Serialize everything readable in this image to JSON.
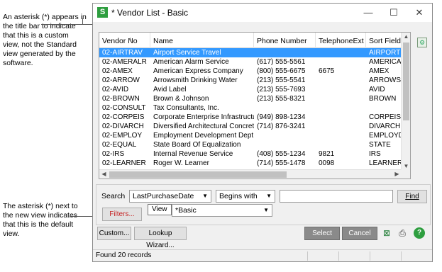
{
  "callouts": {
    "top": "An asterisk (*) appears in the title bar to indicate that this is a custom view, not the Standard view generated by the software.",
    "bottom": "The asterisk (*) next to the new view indicates that this is the default view."
  },
  "window": {
    "title": "* Vendor List - Basic",
    "app_icon_letter": "S",
    "minimize": "—",
    "maximize": "☐",
    "close": "✕"
  },
  "grid": {
    "columns": [
      "Vendor No",
      "Name",
      "Phone Number",
      "TelephoneExt",
      "Sort Field"
    ],
    "rows": [
      [
        "02-AIRTRAV",
        "Airport Service Travel",
        "",
        "",
        "AIRPORT"
      ],
      [
        "02-AMERALR",
        "American Alarm Service",
        "(617) 555-5561",
        "",
        "AMERICAN"
      ],
      [
        "02-AMEX",
        "American Express Company",
        "(800) 555-6675",
        "6675",
        "AMEX"
      ],
      [
        "02-ARROW",
        "Arrowsmith Drinking Water",
        "(213) 555-5541",
        "",
        "ARROWSM"
      ],
      [
        "02-AVID",
        "Avid Label",
        "(213) 555-7693",
        "",
        "AVID"
      ],
      [
        "02-BROWN",
        "Brown & Johnson",
        "(213) 555-8321",
        "",
        "BROWN"
      ],
      [
        "02-CONSULT",
        "Tax Consultants, Inc.",
        "",
        "",
        ""
      ],
      [
        "02-CORPEIS",
        "Corporate Enterprise Infrastructu...",
        "(949) 898-1234",
        "",
        "CORPEIS"
      ],
      [
        "02-DIVARCH",
        "Diversified Architectural Concret...",
        "(714) 876-3241",
        "",
        "DIVARCH"
      ],
      [
        "02-EMPLOY",
        "Employment Development Dept",
        "",
        "",
        "EMPLOYDE"
      ],
      [
        "02-EQUAL",
        "State Board Of Equalization",
        "",
        "",
        "STATE"
      ],
      [
        "02-IRS",
        "Internal Revenue Service",
        "(408) 555-1234",
        "9821",
        "IRS"
      ],
      [
        "02-LEARNER",
        "Roger W. Learner",
        "(714) 555-1478",
        "0098",
        "LEARNER"
      ]
    ],
    "selected_row": 0
  },
  "search": {
    "label": "Search",
    "field": "LastPurchaseDate",
    "operator": "Begins with",
    "value": "",
    "find_label": "Find",
    "filters_label": "Filters...",
    "view_label": "View",
    "view_value": "*Basic"
  },
  "buttons": {
    "custom": "Custom...",
    "lookup_wizard": "Lookup Wizard...",
    "select": "Select",
    "cancel": "Cancel"
  },
  "status": {
    "text": "Found 20 records"
  }
}
